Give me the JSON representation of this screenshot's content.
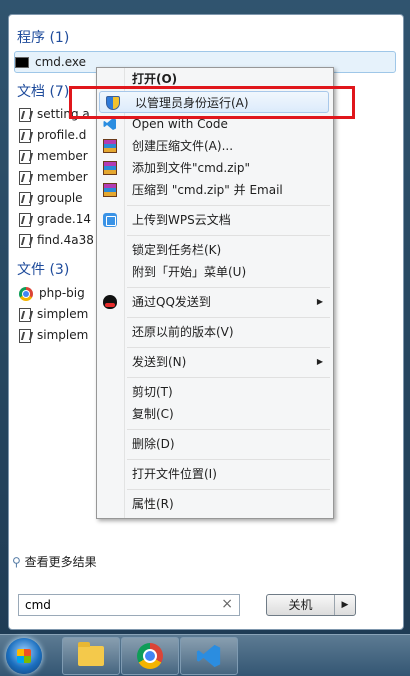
{
  "programs": {
    "title": "程序 (1)",
    "items": [
      {
        "label": "cmd.exe",
        "icon": "cmd-icon"
      }
    ]
  },
  "documents": {
    "title": "文档 (7)",
    "items": [
      {
        "label": "setting.a",
        "icon": "script-file-icon"
      },
      {
        "label": "profile.d",
        "icon": "script-file-icon"
      },
      {
        "label": "member",
        "icon": "script-file-icon"
      },
      {
        "label": "member",
        "icon": "script-file-icon"
      },
      {
        "label": "grouple",
        "icon": "script-file-icon"
      },
      {
        "label": "grade.14",
        "icon": "script-file-icon"
      },
      {
        "label": "find.4a38",
        "icon": "script-file-icon"
      }
    ]
  },
  "files": {
    "title": "文件 (3)",
    "items": [
      {
        "label": "php-big",
        "icon": "chrome-file-icon"
      },
      {
        "label": "simplem",
        "icon": "script-file-icon"
      },
      {
        "label": "simplem",
        "icon": "script-file-icon"
      }
    ]
  },
  "more_results": "查看更多结果",
  "search": {
    "value": "cmd",
    "clear": "×"
  },
  "shutdown": {
    "label": "关机",
    "arrow": "▶"
  },
  "context_menu": {
    "items": [
      {
        "label": "打开(O)"
      },
      {
        "label": "以管理员身份运行(A)"
      },
      {
        "label": "Open with Code"
      },
      {
        "label": "创建压缩文件(A)..."
      },
      {
        "label": "添加到文件\"cmd.zip\""
      },
      {
        "label": "压缩到 \"cmd.zip\" 并 Email"
      },
      {
        "label": "上传到WPS云文档"
      },
      {
        "label": "锁定到任务栏(K)"
      },
      {
        "label": "附到「开始」菜单(U)"
      },
      {
        "label": "通过QQ发送到"
      },
      {
        "label": "还原以前的版本(V)"
      },
      {
        "label": "发送到(N)"
      },
      {
        "label": "剪切(T)"
      },
      {
        "label": "复制(C)"
      },
      {
        "label": "删除(D)"
      },
      {
        "label": "打开文件位置(I)"
      },
      {
        "label": "属性(R)"
      }
    ]
  },
  "colors": {
    "highlight_box": "#e0161b",
    "group_title": "#1e4b9b"
  }
}
